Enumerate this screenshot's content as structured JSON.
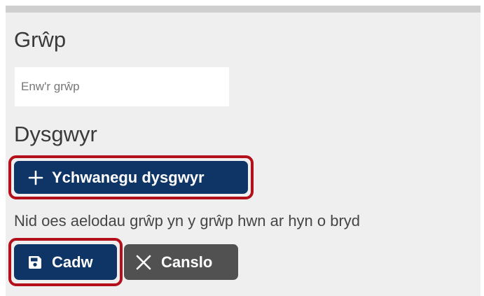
{
  "group": {
    "heading": "Grŵp",
    "name_placeholder": "Enw'r grŵp",
    "name_value": ""
  },
  "learners": {
    "heading": "Dysgwyr",
    "add_button_label": "Ychwanegu dysgwyr",
    "add_button_icon": "plus-icon",
    "empty_message": "Nid oes aelodau grŵp yn y grŵp hwn ar hyn o bryd"
  },
  "actions": {
    "save_label": "Cadw",
    "save_icon": "floppy-disk-icon",
    "cancel_label": "Canslo",
    "cancel_icon": "close-icon"
  },
  "colors": {
    "primary": "#0e3566",
    "secondary": "#515151",
    "highlight": "#b3101b",
    "panel_bg": "#efefef"
  }
}
